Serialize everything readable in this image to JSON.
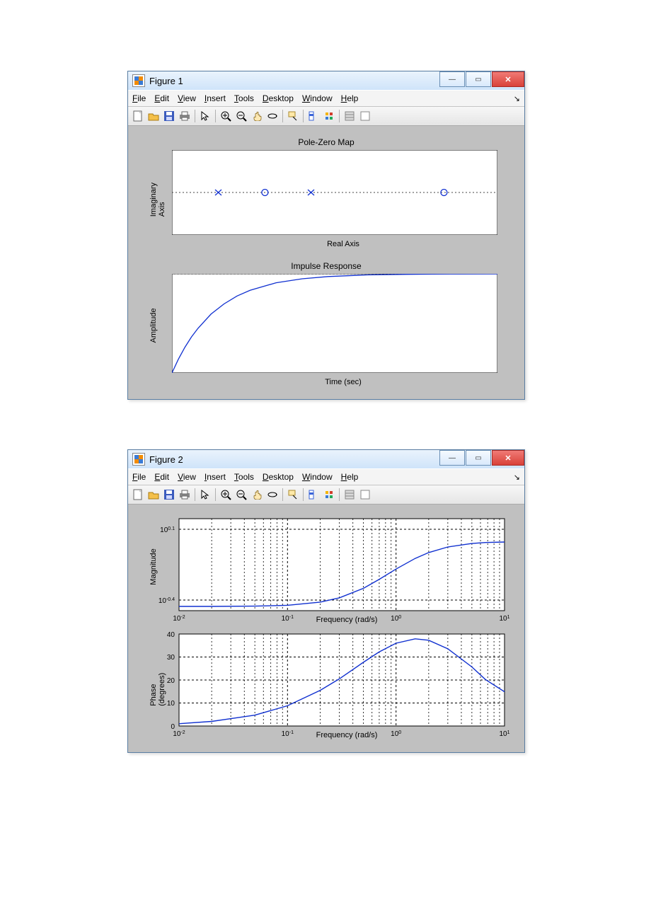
{
  "figures": [
    {
      "title": "Figure 1"
    },
    {
      "title": "Figure 2"
    }
  ],
  "menu": [
    "File",
    "Edit",
    "View",
    "Insert",
    "Tools",
    "Desktop",
    "Window",
    "Help"
  ],
  "toolbar_icons": [
    "new",
    "open",
    "save",
    "print",
    "pointer",
    "zoom-in",
    "zoom-out",
    "pan",
    "rotate3d",
    "datacursor",
    "brush",
    "link",
    "colorbar",
    "legend",
    "insert-colorbar"
  ],
  "chart_data": [
    {
      "type": "scatter",
      "title": "Pole-Zero Map",
      "xlabel": "Real Axis",
      "ylabel": "Imaginary Axis",
      "xlim": [
        -3.5,
        0
      ],
      "ylim": [
        -1,
        1
      ],
      "xticks": [
        -3.5,
        -3,
        -2.5,
        -2,
        -1.5,
        -1,
        -0.5,
        0
      ],
      "yticks": [
        -1,
        -0.5,
        0,
        0.5,
        1
      ],
      "series": [
        {
          "name": "poles",
          "marker": "x",
          "points": [
            [
              -3,
              0
            ],
            [
              -2,
              0
            ]
          ]
        },
        {
          "name": "zeros",
          "marker": "o",
          "points": [
            [
              -2.5,
              0
            ],
            [
              -0.575,
              0
            ]
          ]
        }
      ],
      "refline_y": 0
    },
    {
      "type": "line",
      "title": "Impulse Response",
      "xlabel": "Time (sec)",
      "ylabel": "Amplitude",
      "xlim": [
        0,
        2.5
      ],
      "ylim": [
        -3,
        0
      ],
      "xticks": [
        0,
        0.5,
        1,
        1.5,
        2,
        2.5
      ],
      "yticks": [
        -3,
        -2,
        -1,
        0
      ],
      "refline_y": 0,
      "x": [
        0,
        0.05,
        0.1,
        0.15,
        0.2,
        0.3,
        0.4,
        0.5,
        0.6,
        0.8,
        1.0,
        1.2,
        1.5,
        1.8,
        2.0,
        2.2,
        2.5
      ],
      "values": [
        -3,
        -2.58,
        -2.22,
        -1.91,
        -1.65,
        -1.22,
        -0.91,
        -0.67,
        -0.5,
        -0.27,
        -0.15,
        -0.082,
        -0.033,
        -0.014,
        -0.0074,
        -0.0041,
        -0.0017
      ]
    },
    {
      "type": "line",
      "title": "",
      "xlabel": "Frequency (rad/s)",
      "ylabel": "Magnitude",
      "x_scale": "log",
      "y_scale": "log",
      "xlim": [
        0.01,
        10
      ],
      "ylim_label_top": "10^0.1",
      "ylim_label_bot": "10^-0.4",
      "ylim": [
        0.398,
        1.259
      ],
      "xticks": [
        0.01,
        0.1,
        1,
        10
      ],
      "xtick_labels": [
        "10^-2",
        "10^-1",
        "10^0",
        "10^1"
      ],
      "x": [
        0.01,
        0.02,
        0.05,
        0.1,
        0.2,
        0.3,
        0.5,
        0.7,
        1,
        1.5,
        2,
        3,
        5,
        7,
        10
      ],
      "values": [
        0.417,
        0.417,
        0.419,
        0.425,
        0.448,
        0.482,
        0.569,
        0.664,
        0.791,
        0.944,
        1.04,
        1.137,
        1.206,
        1.226,
        1.238
      ]
    },
    {
      "type": "line",
      "title": "",
      "xlabel": "Frequency (rad/s)",
      "ylabel": "Phase (degrees)",
      "x_scale": "log",
      "xlim": [
        0.01,
        10
      ],
      "ylim": [
        0,
        40
      ],
      "xticks": [
        0.01,
        0.1,
        1,
        10
      ],
      "xtick_labels": [
        "10^-2",
        "10^-1",
        "10^0",
        "10^1"
      ],
      "yticks": [
        0,
        10,
        20,
        30,
        40
      ],
      "x": [
        0.01,
        0.02,
        0.05,
        0.1,
        0.2,
        0.3,
        0.5,
        0.7,
        1,
        1.5,
        2,
        3,
        5,
        7,
        10
      ],
      "values": [
        1.0,
        2.0,
        4.7,
        8.8,
        15.5,
        20.5,
        27.7,
        32.2,
        36.0,
        37.9,
        37.3,
        33.6,
        25.7,
        20.2,
        14.9
      ]
    }
  ]
}
